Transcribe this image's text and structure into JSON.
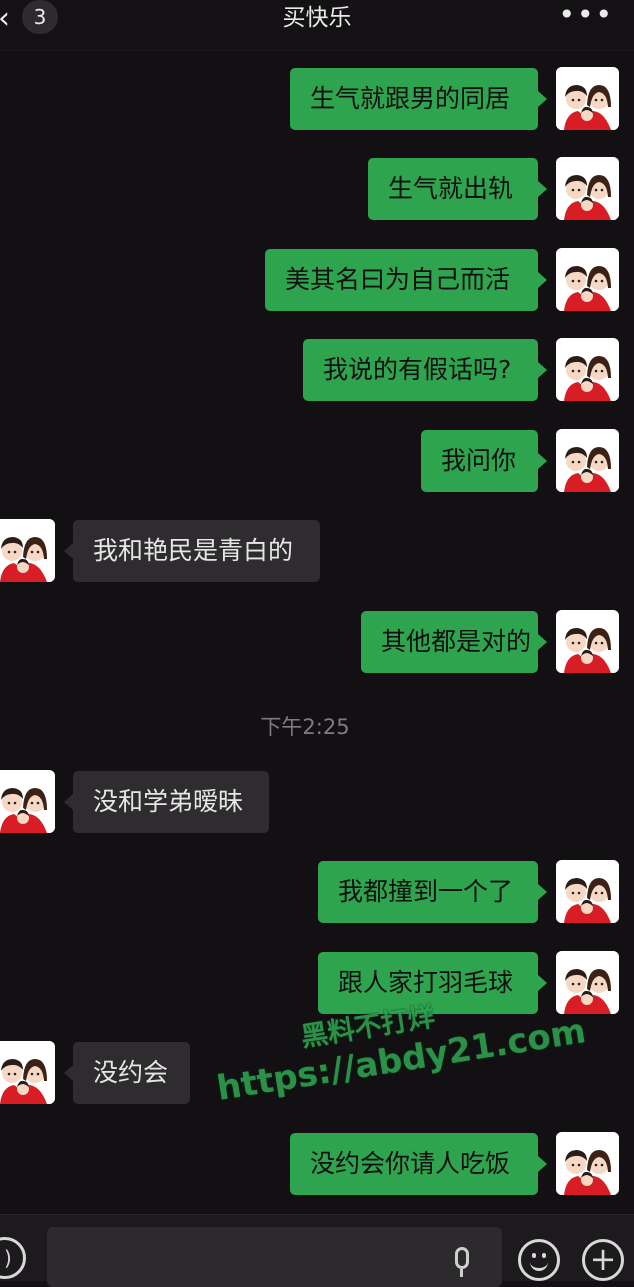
{
  "header": {
    "back_icon": "chevron-left-icon",
    "unread_count": "3",
    "title": "买快乐",
    "more_icon": "more-dots-icon",
    "more_label": "•••"
  },
  "messages": [
    {
      "side": "me",
      "text": "生气就跟男的同居"
    },
    {
      "side": "me",
      "text": "生气就出轨"
    },
    {
      "side": "me",
      "text": "美其名曰为自己而活"
    },
    {
      "side": "me",
      "text": "我说的有假话吗?"
    },
    {
      "side": "me",
      "text": "我问你"
    },
    {
      "side": "other",
      "text": "我和艳民是青白的"
    },
    {
      "side": "me",
      "text": "其他都是对的"
    },
    {
      "side": "other",
      "text": "没和学弟暧昧"
    },
    {
      "side": "me",
      "text": "我都撞到一个了"
    },
    {
      "side": "me",
      "text": "跟人家打羽毛球"
    },
    {
      "side": "other",
      "text": "没约会"
    },
    {
      "side": "me",
      "text": "没约会你请人吃饭"
    }
  ],
  "timestamp": "下午2:25",
  "watermark": {
    "line1": "黑料不打烊",
    "line2": "https://abdy21.com"
  },
  "bottombar": {
    "voice_icon": "voice-icon",
    "mic_icon": "microphone-icon",
    "emoji_icon": "emoji-icon",
    "plus_icon": "plus-icon",
    "plus_label": "+"
  }
}
